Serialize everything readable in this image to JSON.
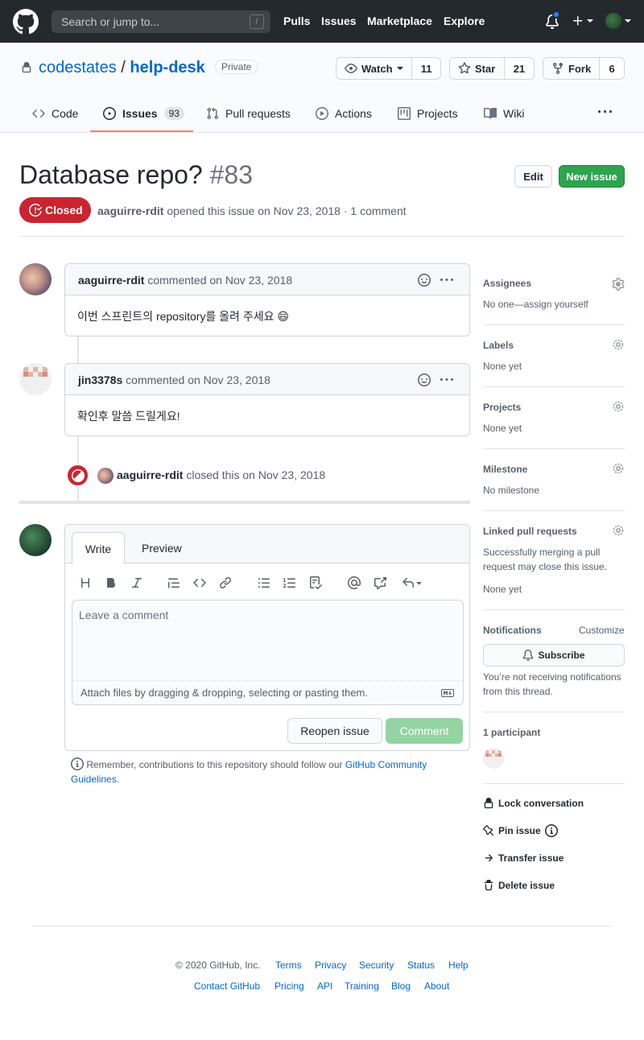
{
  "header": {
    "search_placeholder": "Search or jump to...",
    "search_shortcut": "/",
    "nav": [
      "Pulls",
      "Issues",
      "Marketplace",
      "Explore"
    ]
  },
  "repo": {
    "owner": "codestates",
    "separator": "/",
    "name": "help-desk",
    "visibility": "Private",
    "watch_label": "Watch",
    "watch_count": "11",
    "star_label": "Star",
    "star_count": "21",
    "fork_label": "Fork",
    "fork_count": "6",
    "tabs": [
      {
        "label": "Code"
      },
      {
        "label": "Issues",
        "count": "93"
      },
      {
        "label": "Pull requests"
      },
      {
        "label": "Actions"
      },
      {
        "label": "Projects"
      },
      {
        "label": "Wiki"
      }
    ],
    "more": "···"
  },
  "issue": {
    "title": "Database repo?",
    "number": "#83",
    "edit_label": "Edit",
    "new_issue_label": "New issue",
    "state": "Closed",
    "author": "aaguirre-rdit",
    "meta_text": "opened this issue on Nov 23, 2018 · 1 comment"
  },
  "comments": [
    {
      "author": "aaguirre-rdit",
      "action": "commented on Nov 23, 2018",
      "body": "이번 스프린트의 repository를 올려 주세요 😄"
    },
    {
      "author": "jin3378s",
      "action": "commented on Nov 23, 2018",
      "body": "확인후 말씀 드릴게요!"
    }
  ],
  "event": {
    "author": "aaguirre-rdit",
    "text": "closed this on Nov 23, 2018"
  },
  "editor": {
    "write_tab": "Write",
    "preview_tab": "Preview",
    "placeholder": "Leave a comment",
    "attach_text": "Attach files by dragging & dropping, selecting or pasting them.",
    "reopen_label": "Reopen issue",
    "comment_label": "Comment",
    "guideline_text": "Remember, contributions to this repository should follow our ",
    "guideline_link": "GitHub Community Guidelines",
    "guideline_end": "."
  },
  "sidebar": {
    "assignees_title": "Assignees",
    "assignees_value": "No one—assign yourself",
    "labels_title": "Labels",
    "labels_value": "None yet",
    "projects_title": "Projects",
    "projects_value": "None yet",
    "milestone_title": "Milestone",
    "milestone_value": "No milestone",
    "linked_title": "Linked pull requests",
    "linked_desc": "Successfully merging a pull request may close this issue.",
    "linked_value": "None yet",
    "notifications_title": "Notifications",
    "customize": "Customize",
    "subscribe": "Subscribe",
    "notif_text": "You’re not receiving notifications from this thread.",
    "participants": "1 participant",
    "lock": "Lock conversation",
    "pin": "Pin issue",
    "transfer": "Transfer issue",
    "delete": "Delete issue"
  },
  "footer": {
    "copyright": "© 2020 GitHub, Inc.",
    "row1": [
      "Terms",
      "Privacy",
      "Security",
      "Status",
      "Help"
    ],
    "row2": [
      "Contact GitHub",
      "Pricing",
      "API",
      "Training",
      "Blog",
      "About"
    ]
  },
  "colors": {
    "header_bg": "#24292e",
    "link": "#0366d6",
    "closed_red": "#cb2431",
    "green": "#2ea44f",
    "tab_underline": "#f9826c"
  }
}
